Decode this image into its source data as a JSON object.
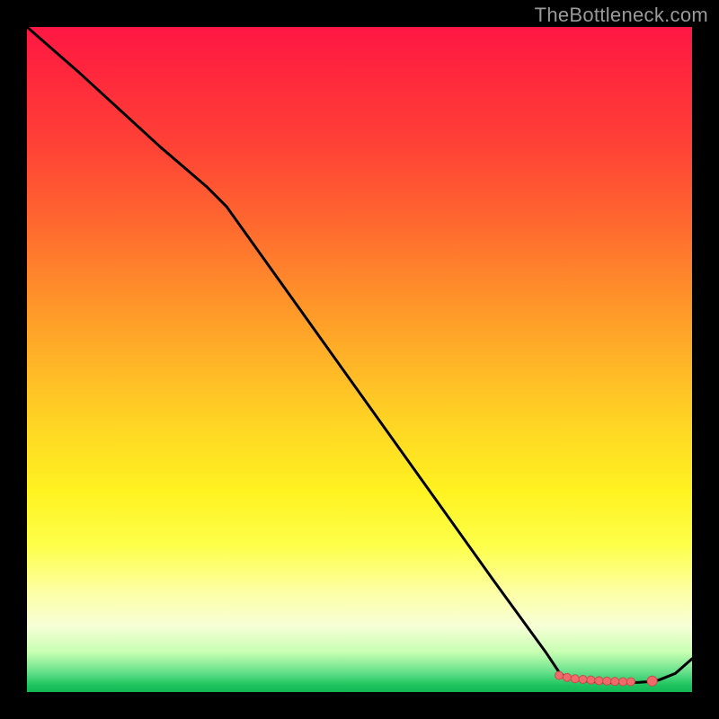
{
  "watermark": "TheBottleneck.com",
  "colors": {
    "curve": "#000000",
    "markers_fill": "#ef6b6b",
    "markers_stroke": "#c94d4d",
    "bg": "#000000"
  },
  "chart_data": {
    "type": "line",
    "title": "",
    "xlabel": "",
    "ylabel": "",
    "xlim": [
      0,
      100
    ],
    "ylim": [
      0,
      100
    ],
    "grid": false,
    "series": [
      {
        "name": "curve",
        "x": [
          0,
          8,
          20,
          27,
          30,
          40,
          50,
          60,
          70,
          78,
          80,
          81,
          83,
          84.5,
          86,
          87.5,
          89,
          90.5,
          92,
          93.5,
          95,
          97.5,
          100
        ],
        "values": [
          100,
          93,
          82,
          76,
          73,
          59,
          45,
          31,
          17,
          6,
          3,
          2.2,
          1.8,
          1.6,
          1.5,
          1.45,
          1.4,
          1.4,
          1.45,
          1.55,
          1.8,
          2.8,
          5
        ]
      }
    ],
    "markers": [
      {
        "x": 80.0,
        "y": 2.5
      },
      {
        "x": 81.2,
        "y": 2.2
      },
      {
        "x": 82.4,
        "y": 2.0
      },
      {
        "x": 83.6,
        "y": 1.9
      },
      {
        "x": 84.8,
        "y": 1.8
      },
      {
        "x": 86.0,
        "y": 1.7
      },
      {
        "x": 87.2,
        "y": 1.65
      },
      {
        "x": 88.4,
        "y": 1.6
      },
      {
        "x": 89.6,
        "y": 1.55
      },
      {
        "x": 90.8,
        "y": 1.55
      },
      {
        "x": 94.0,
        "y": 1.65
      }
    ],
    "gradient_stops": [
      {
        "pos": 0.0,
        "color": "#ff1744"
      },
      {
        "pos": 0.5,
        "color": "#ffd624"
      },
      {
        "pos": 0.85,
        "color": "#fdffa5"
      },
      {
        "pos": 1.0,
        "color": "#13b854"
      }
    ]
  }
}
